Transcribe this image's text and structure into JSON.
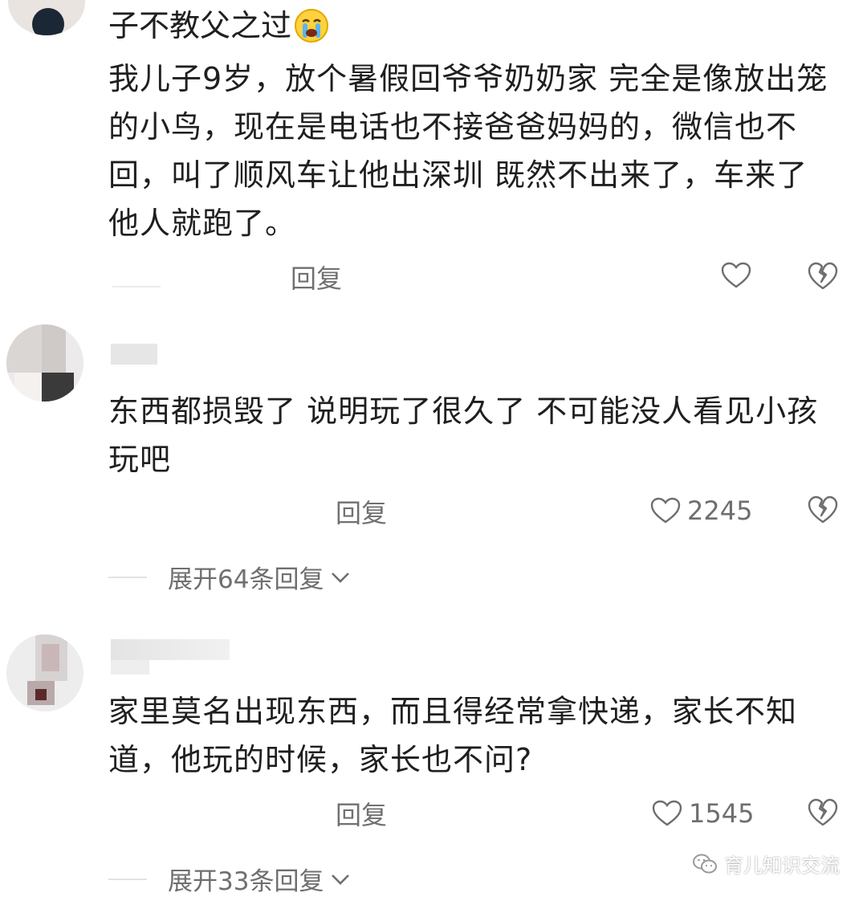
{
  "comments": [
    {
      "heading": "子不教父之过",
      "emoji": "crying-face-icon",
      "body": "我儿子9岁，放个暑假回爷爷奶奶家 完全是像放出笼的小鸟，现在是电话也不接爸爸妈妈的，微信也不回，叫了顺风车让他出深圳 既然不出来了，车来了 他人就跑了。",
      "reply_label": "回复",
      "likes": ""
    },
    {
      "body": "东西都损毁了 说明玩了很久了 不可能没人看见小孩玩吧",
      "reply_label": "回复",
      "likes": "2245",
      "expand_label": "展开64条回复"
    },
    {
      "body": "家里莫名出现东西，而且得经常拿快递，家长不知道，他玩的时候，家长也不问?",
      "reply_label": "回复",
      "likes": "1545",
      "expand_label": "展开33条回复"
    }
  ],
  "watermark": {
    "icon": "wechat-icon",
    "text": "育儿知识交流"
  },
  "colors": {
    "text": "#1f1f1f",
    "muted": "#707070",
    "background": "#ffffff"
  }
}
